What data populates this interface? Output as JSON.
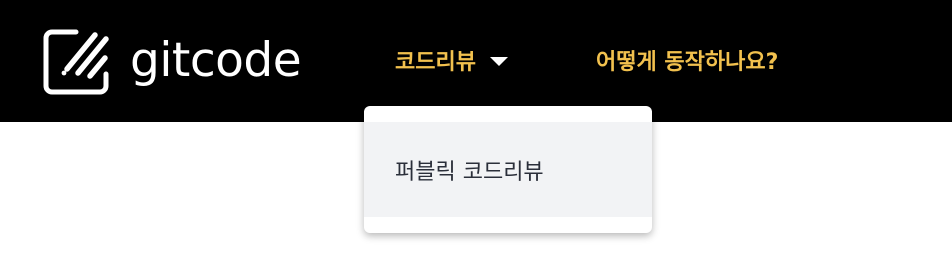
{
  "header": {
    "logo_text": "gitcode",
    "logo_icon": "gitcode-logo-icon",
    "nav": {
      "code_review_label": "코드리뷰",
      "how_it_works_label": "어떻게 동작하나요?"
    }
  },
  "dropdown": {
    "items": [
      {
        "label": "퍼블릭 코드리뷰"
      }
    ]
  },
  "colors": {
    "navbar_bg": "#000000",
    "nav_link": "#f2c14e",
    "dropdown_item_bg": "#f2f3f5",
    "dropdown_text": "#2b2f3a"
  }
}
